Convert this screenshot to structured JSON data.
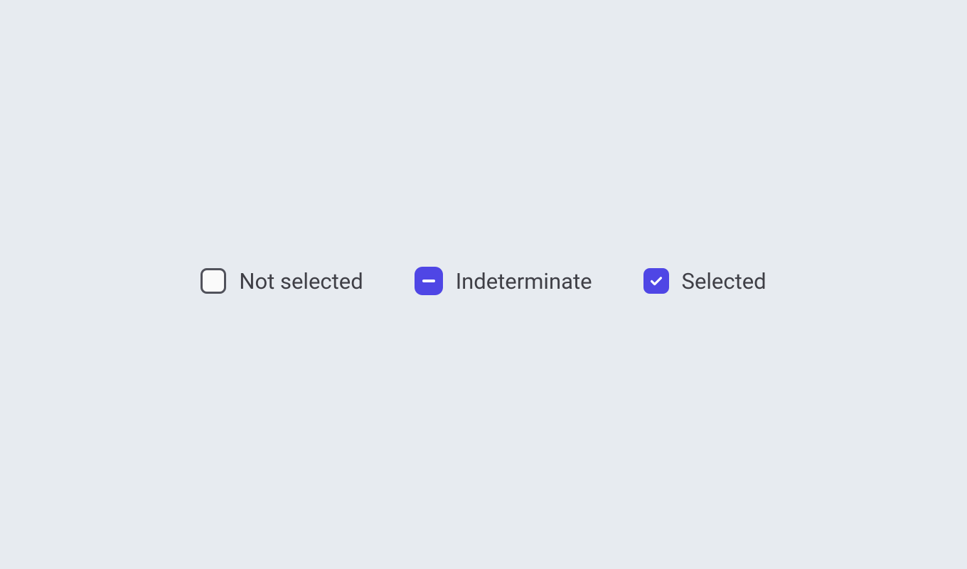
{
  "checkboxes": {
    "not_selected": {
      "label": "Not selected",
      "state": "unchecked"
    },
    "indeterminate": {
      "label": "Indeterminate",
      "state": "indeterminate"
    },
    "selected": {
      "label": "Selected",
      "state": "checked"
    }
  },
  "colors": {
    "accent": "#4f46e5",
    "background": "#e7ebf0",
    "text": "#3f3f46",
    "border": "#51525b"
  }
}
